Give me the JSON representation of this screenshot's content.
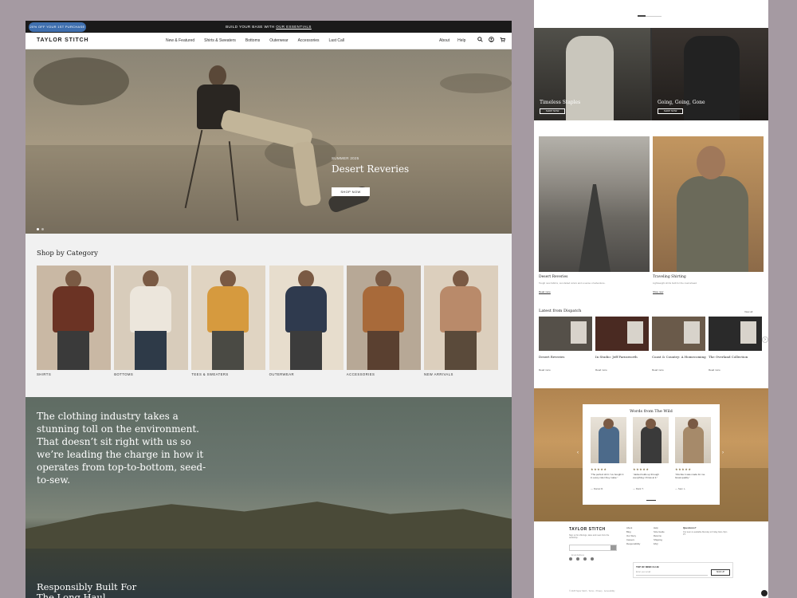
{
  "announcement": {
    "promo": "20% OFF YOUR 1ST PURCHASE",
    "text": "BUILD YOUR BASE WITH ",
    "link": "OUR ESSENTIALS"
  },
  "nav": {
    "logo": "TAYLOR STITCH",
    "links": [
      "New & Featured",
      "Shirts & Sweaters",
      "Bottoms",
      "Outerwear",
      "Accessories",
      "Last Call"
    ],
    "right": [
      "About",
      "Help"
    ],
    "icons": [
      "search-icon",
      "account-icon",
      "cart-icon"
    ]
  },
  "hero": {
    "subtitle": "SUMMER 2025",
    "title": "Desert Reveries",
    "cta": "SHOP NOW",
    "slides": 2,
    "active_slide": 1
  },
  "categories": {
    "title": "Shop by Category",
    "items": [
      {
        "label": "SHIRTS",
        "bg": "#c9b8a4",
        "top": "#6b3324",
        "bottom": "#3a3a3a"
      },
      {
        "label": "BOTTOMS",
        "bg": "#d8ccbb",
        "top": "#ece6dc",
        "bottom": "#2e3a48"
      },
      {
        "label": "TEES & SWEATERS",
        "bg": "#e0d4c2",
        "top": "#d69a3e",
        "bottom": "#4a4a44"
      },
      {
        "label": "OUTERWEAR",
        "bg": "#e7ddcd",
        "top": "#2f3a4e",
        "bottom": "#3c3c3c"
      },
      {
        "label": "ACCESSORIES",
        "bg": "#b7a896",
        "top": "#a86a3a",
        "bottom": "#5a4030"
      },
      {
        "label": "NEW ARRIVALS",
        "bg": "#dccfbd",
        "top": "#b98a6a",
        "bottom": "#5a4a3a"
      }
    ]
  },
  "sustainability": {
    "text": "The clothing industry takes a stunning toll on the environment. That doesn’t sit right with us so we’re leading the charge in how it operates from top-to-bottom, seed-to-sew.",
    "bottom_heading": "Responsibly Built For The Long Haul"
  },
  "right": {
    "steep": [
      {
        "title": "Timeless Staples",
        "cta": "SHOP NOW"
      },
      {
        "title": "Going, Going, Gone",
        "cta": "SHOP NOW"
      }
    ],
    "editorial": [
      {
        "title": "Desert Reveries",
        "desc": "Tough new fabrics, sun-faded colors and a sense of adventure.",
        "link": "Read more"
      },
      {
        "title": "Traveling Shirting",
        "desc": "Lightweight shirts built for the road ahead.",
        "link": "Shop now"
      }
    ],
    "dispatch": {
      "heading": "Latest from Dispatch",
      "view_all": "View all",
      "items": [
        {
          "title": "Desert Reveries",
          "color": "#555049",
          "link": "Read more"
        },
        {
          "title": "In Studio: Jeff Farnsworth",
          "color": "#4a2a22",
          "link": "Read more"
        },
        {
          "title": "Coast & Country: A Homecoming",
          "color": "#6a5a4a",
          "link": "Read more"
        },
        {
          "title": "The Overland Collection",
          "color": "#2a2a2a",
          "link": "Read more"
        }
      ]
    },
    "words": {
      "heading": "Words from The Wild",
      "reviews": [
        {
          "stars": "★★★★★",
          "quote": "“The perfect shirt. I’ve bought it in every color they make.”",
          "name": "— Daniel R.",
          "color": "#4c6a8a"
        },
        {
          "stars": "★★★★★",
          "quote": "“Jacket holds up through everything I throw at it.”",
          "name": "— Mark T.",
          "color": "#3a3a3a"
        },
        {
          "stars": "★★★★★",
          "quote": "“Fits like it was made for me. Great quality.”",
          "name": "— Sam L.",
          "color": "#a68a6a"
        }
      ]
    },
    "footer": {
      "logo": "TAYLOR STITCH",
      "desc": "Sign up for offerings, tales and news from the workshop.",
      "email_placeholder": "Email Address",
      "col1": [
        "About",
        "Blog",
        "Our Story",
        "Careers",
        "Responsibility"
      ],
      "col2": [
        "Help",
        "Size Guide",
        "Returns",
        "Shipping",
        "FAQ"
      ],
      "cust_head": "Questions?",
      "cust_desc": "Our team is available Monday to Friday 9am–5pm PT.",
      "club_title": "TOP OF MIND CLUB",
      "club_placeholder": "Enter your email",
      "club_btn": "SIGN UP",
      "bottom": "© 2025 Taylor Stitch · Terms · Privacy · Accessibility"
    }
  }
}
